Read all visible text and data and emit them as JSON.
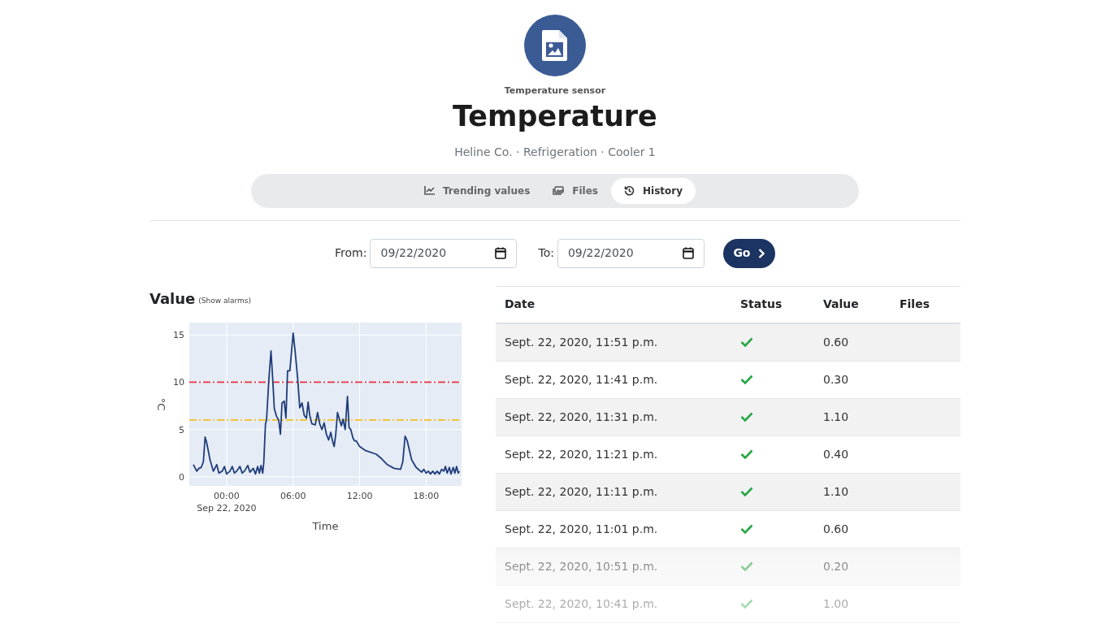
{
  "header": {
    "subtitle": "Temperature sensor",
    "title": "Temperature",
    "breadcrumb": "Heline Co. · Refrigeration · Cooler 1"
  },
  "tabs": [
    {
      "label": "Trending values",
      "selected": false
    },
    {
      "label": "Files",
      "selected": false
    },
    {
      "label": "History",
      "selected": true
    }
  ],
  "date_filter": {
    "from_label": "From:",
    "from_value": "09/22/2020",
    "to_label": "To:",
    "to_value": "09/22/2020",
    "button": "Go"
  },
  "chart_panel": {
    "title": "Value",
    "alarms_link": "(Show alarms)",
    "chart_data": {
      "type": "line",
      "xlabel": "Time",
      "ylabel": "°C",
      "xlim": [
        -3.37,
        21.2
      ],
      "ylim": [
        -0.95,
        16.3
      ],
      "yticks": [
        0,
        5,
        10,
        15
      ],
      "xticks": [
        {
          "value": 0,
          "label": "00:00 Sep 22, 2020"
        },
        {
          "value": 6,
          "label": "06:00"
        },
        {
          "value": 12,
          "label": "12:00"
        },
        {
          "value": 18,
          "label": "18:00"
        }
      ],
      "x": [
        -3.0,
        -2.7,
        -2.5,
        -2.3,
        -2.1,
        -1.95,
        -1.8,
        -1.5,
        -1.2,
        -0.9,
        -0.7,
        -0.4,
        -0.2,
        0.0,
        0.3,
        0.5,
        0.7,
        0.9,
        1.2,
        1.4,
        1.6,
        1.9,
        2.1,
        2.4,
        2.6,
        2.8,
        2.95,
        3.1,
        3.25,
        3.35,
        3.5,
        3.6,
        3.8,
        4.0,
        4.15,
        4.3,
        4.5,
        4.7,
        4.85,
        5.0,
        5.2,
        5.35,
        5.5,
        5.7,
        6.0,
        6.2,
        6.4,
        6.6,
        6.8,
        7.0,
        7.2,
        7.35,
        7.5,
        7.7,
        8.0,
        8.2,
        8.4,
        8.6,
        8.8,
        9.0,
        9.2,
        9.4,
        9.55,
        9.7,
        9.85,
        10.0,
        10.2,
        10.35,
        10.5,
        10.7,
        10.9,
        11.05,
        11.2,
        11.4,
        11.55,
        11.7,
        12.0,
        12.5,
        13.5,
        14.0,
        14.5,
        15.1,
        15.7,
        15.9,
        16.1,
        16.3,
        16.7,
        17.1,
        17.6,
        17.8,
        18.0,
        18.2,
        18.4,
        18.6,
        18.8,
        19.0,
        19.2,
        19.4,
        19.6,
        19.75,
        19.9,
        20.1,
        20.25,
        20.45,
        20.6,
        20.75,
        20.9,
        21.0
      ],
      "series": [
        {
          "color": "#1f3c7a",
          "values": [
            1.3,
            0.6,
            0.9,
            1.0,
            1.6,
            4.2,
            3.6,
            1.8,
            0.6,
            1.3,
            0.4,
            0.6,
            1.1,
            0.3,
            0.6,
            1.1,
            0.4,
            0.6,
            1.1,
            0.4,
            0.6,
            1.2,
            0.5,
            0.9,
            0.3,
            1.1,
            0.4,
            1.2,
            0.4,
            1.5,
            5.6,
            6.0,
            10.2,
            13.3,
            10.5,
            7.2,
            6.4,
            6.0,
            4.5,
            7.8,
            8.0,
            6.2,
            11.2,
            11.2,
            15.2,
            13.0,
            10.5,
            7.3,
            7.8,
            6.5,
            6.2,
            7.9,
            6.5,
            5.6,
            5.5,
            6.8,
            5.6,
            5.0,
            5.7,
            4.5,
            3.9,
            4.7,
            3.8,
            3.2,
            4.5,
            6.8,
            6.0,
            5.4,
            6.1,
            5.0,
            8.5,
            5.2,
            5.0,
            4.1,
            3.8,
            3.8,
            3.2,
            2.8,
            2.4,
            1.9,
            1.3,
            0.9,
            0.8,
            1.6,
            4.3,
            3.8,
            1.8,
            1.0,
            0.5,
            0.8,
            0.4,
            0.6,
            0.3,
            0.6,
            0.3,
            0.6,
            0.3,
            0.8,
            0.6,
            1.1,
            0.4,
            1.0,
            0.3,
            1.0,
            0.4,
            1.1,
            0.4,
            0.6
          ]
        }
      ],
      "grid": true,
      "ref_lines": [
        {
          "axis": "y",
          "value": 10,
          "color": "#e8333f"
        },
        {
          "axis": "y",
          "value": 6,
          "color": "#f5b800"
        }
      ]
    }
  },
  "table": {
    "columns": [
      "Date",
      "Status",
      "Value",
      "Files"
    ],
    "rows": [
      {
        "date": "Sept. 22, 2020, 11:51 p.m.",
        "ok": true,
        "value": "0.60"
      },
      {
        "date": "Sept. 22, 2020, 11:41 p.m.",
        "ok": true,
        "value": "0.30"
      },
      {
        "date": "Sept. 22, 2020, 11:31 p.m.",
        "ok": true,
        "value": "1.10"
      },
      {
        "date": "Sept. 22, 2020, 11:21 p.m.",
        "ok": true,
        "value": "0.40"
      },
      {
        "date": "Sept. 22, 2020, 11:11 p.m.",
        "ok": true,
        "value": "1.10"
      },
      {
        "date": "Sept. 22, 2020, 11:01 p.m.",
        "ok": true,
        "value": "0.60"
      },
      {
        "date": "Sept. 22, 2020, 10:51 p.m.",
        "ok": true,
        "value": "0.20"
      },
      {
        "date": "Sept. 22, 2020, 10:41 p.m.",
        "ok": true,
        "value": "1.00"
      }
    ]
  }
}
